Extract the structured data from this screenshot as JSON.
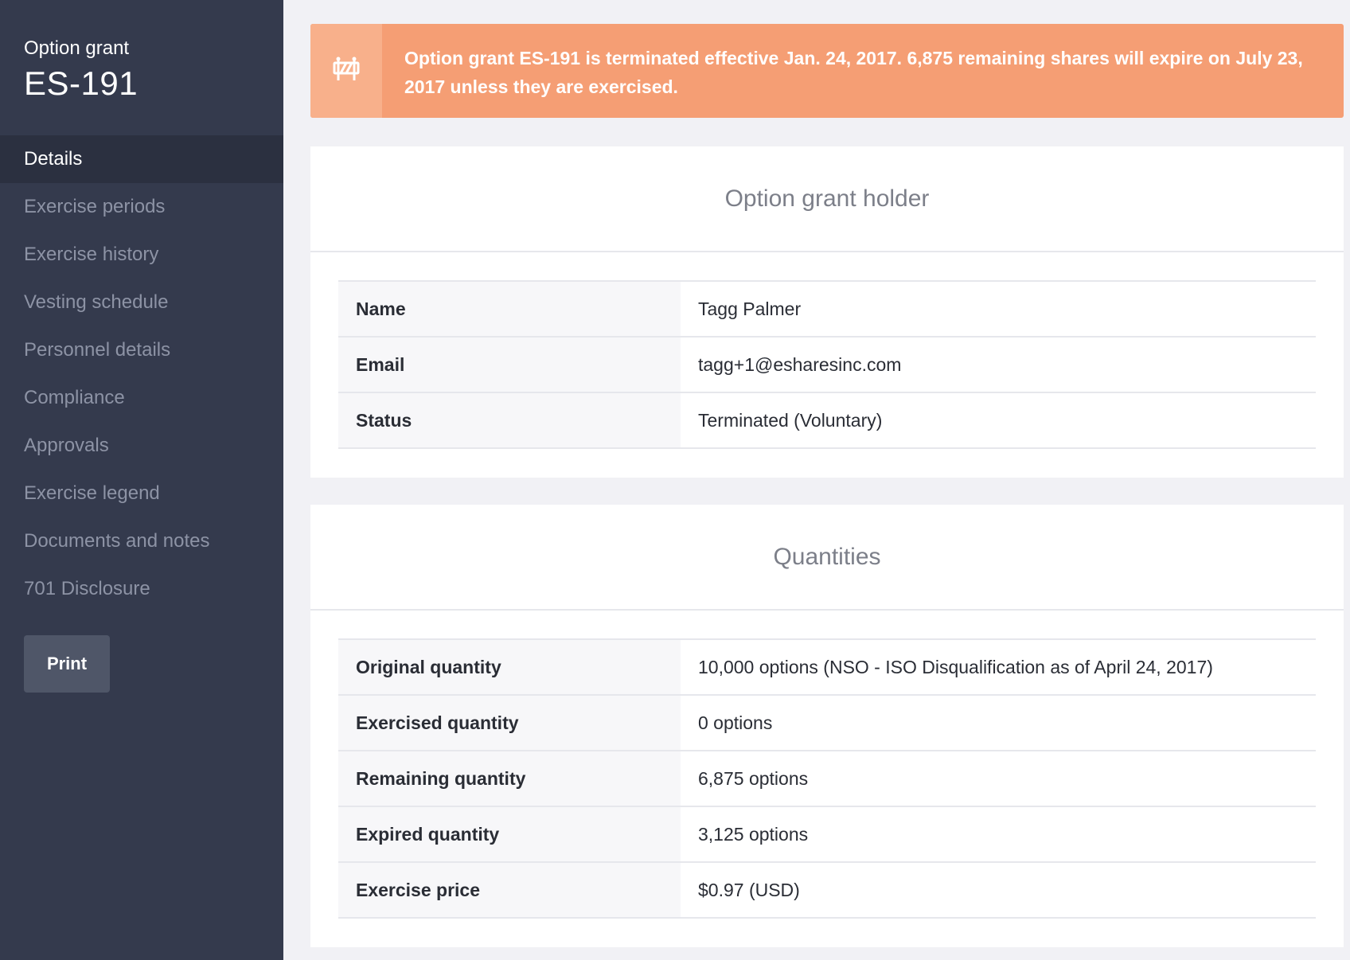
{
  "sidebar": {
    "subtitle": "Option grant",
    "title": "ES-191",
    "items": [
      {
        "label": "Details",
        "active": true
      },
      {
        "label": "Exercise periods"
      },
      {
        "label": "Exercise history"
      },
      {
        "label": "Vesting schedule"
      },
      {
        "label": "Personnel details"
      },
      {
        "label": "Compliance"
      },
      {
        "label": "Approvals"
      },
      {
        "label": "Exercise legend"
      },
      {
        "label": "Documents and notes"
      },
      {
        "label": "701 Disclosure"
      }
    ],
    "print_label": "Print"
  },
  "alert": {
    "icon": "barrier-icon",
    "message": "Option grant ES-191 is terminated effective Jan. 24, 2017. 6,875 remaining shares will expire on July 23, 2017 unless they are exercised."
  },
  "holder": {
    "title": "Option grant holder",
    "rows": [
      {
        "key": "Name",
        "value": "Tagg Palmer"
      },
      {
        "key": "Email",
        "value": "tagg+1@esharesinc.com"
      },
      {
        "key": "Status",
        "value": "Terminated (Voluntary)"
      }
    ]
  },
  "quantities": {
    "title": "Quantities",
    "rows": [
      {
        "key": "Original quantity",
        "value": "10,000 options (NSO - ISO Disqualification as of April 24, 2017)"
      },
      {
        "key": "Exercised quantity",
        "value": "0 options"
      },
      {
        "key": "Remaining quantity",
        "value": "6,875 options"
      },
      {
        "key": "Expired quantity",
        "value": "3,125 options"
      },
      {
        "key": "Exercise price",
        "value": "$0.97 (USD)"
      }
    ]
  },
  "colors": {
    "sidebar_bg": "#343a4d",
    "sidebar_active_bg": "#2b3040",
    "alert_bg": "#f59e74",
    "alert_icon_bg": "#f8b08b",
    "page_bg": "#f1f1f5"
  }
}
